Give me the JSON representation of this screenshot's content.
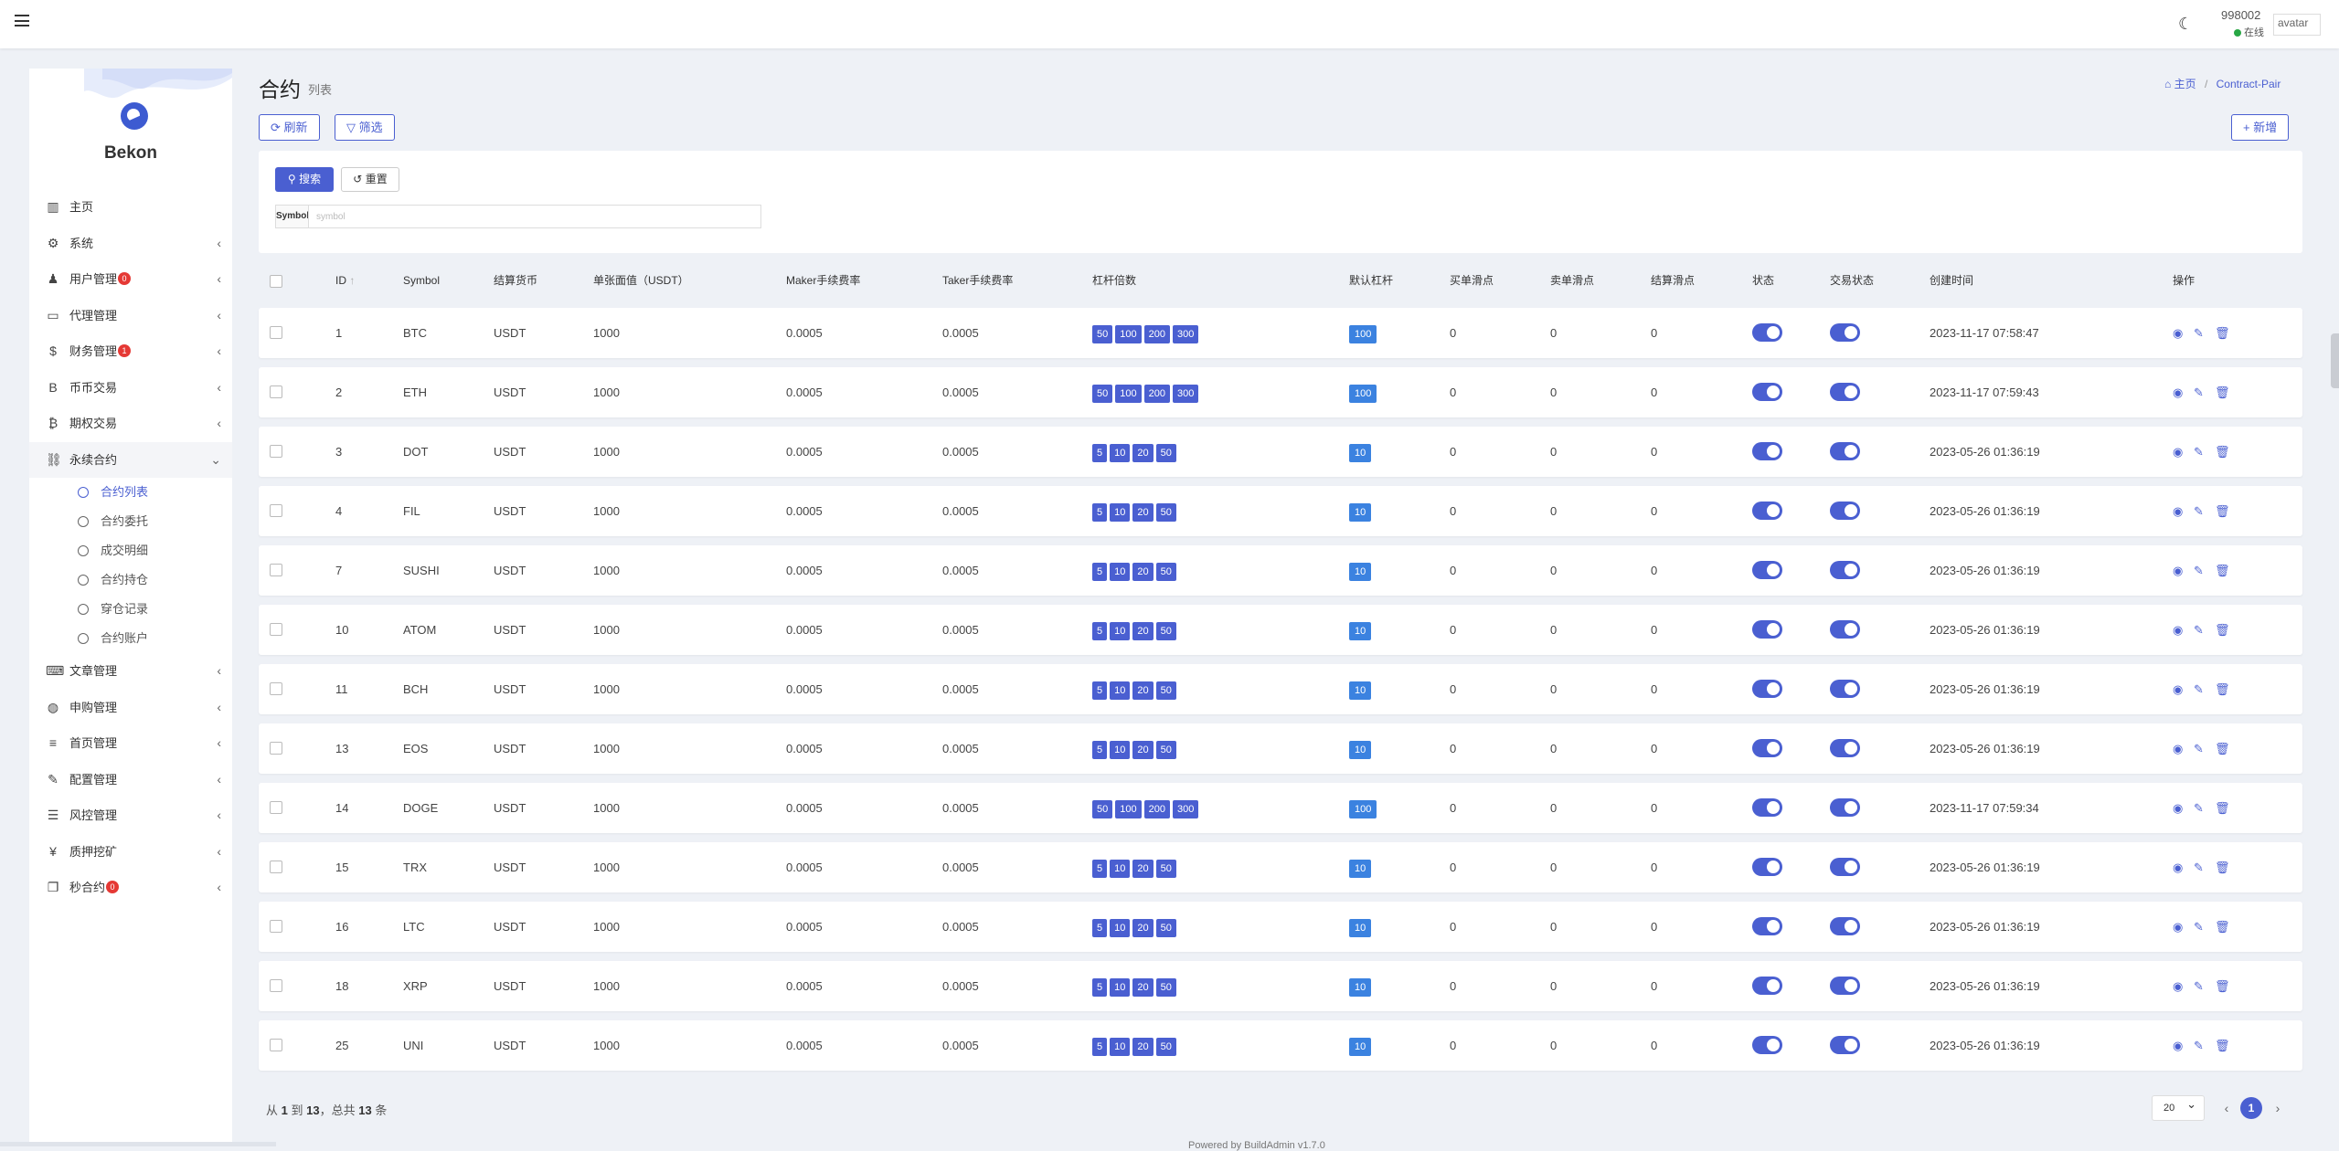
{
  "header": {
    "user_id": "998002",
    "status": "在线",
    "avatar_alt": "avatar"
  },
  "brand": {
    "name": "Bekon"
  },
  "sidebar": {
    "items": [
      {
        "label": "主页",
        "icon": "chart-bar-icon",
        "badge": null,
        "chevron": false
      },
      {
        "label": "系统",
        "icon": "gear-icon",
        "badge": null,
        "chevron": true
      },
      {
        "label": "用户管理",
        "icon": "users-icon",
        "badge": "0",
        "chevron": true
      },
      {
        "label": "代理管理",
        "icon": "id-card-icon",
        "badge": null,
        "chevron": true
      },
      {
        "label": "财务管理",
        "icon": "dollar-icon",
        "badge": "1",
        "chevron": true
      },
      {
        "label": "币币交易",
        "icon": "bitcoin-b-icon",
        "badge": null,
        "chevron": true
      },
      {
        "label": "期权交易",
        "icon": "bitcoin-icon",
        "badge": null,
        "chevron": true
      },
      {
        "label": "永续合约",
        "icon": "link-icon",
        "badge": null,
        "chevron": true,
        "expanded": true
      }
    ],
    "sub_items": [
      {
        "label": "合约列表",
        "active": true
      },
      {
        "label": "合约委托",
        "active": false
      },
      {
        "label": "成交明细",
        "active": false
      },
      {
        "label": "合约持仓",
        "active": false
      },
      {
        "label": "穿仓记录",
        "active": false
      },
      {
        "label": "合约账户",
        "active": false
      }
    ],
    "items_after": [
      {
        "label": "文章管理",
        "icon": "keyboard-icon",
        "badge": null
      },
      {
        "label": "申购管理",
        "icon": "globe-icon",
        "badge": null
      },
      {
        "label": "首页管理",
        "icon": "bars-icon",
        "badge": null
      },
      {
        "label": "配置管理",
        "icon": "wrench-icon",
        "badge": null
      },
      {
        "label": "风控管理",
        "icon": "list-icon",
        "badge": null
      },
      {
        "label": "质押挖矿",
        "icon": "yen-icon",
        "badge": null
      },
      {
        "label": "秒合约",
        "icon": "copy-icon",
        "badge": "0"
      }
    ]
  },
  "page": {
    "title": "合约",
    "subtitle": "列表",
    "breadcrumb_home": "主页",
    "breadcrumb_current": "Contract-Pair"
  },
  "toolbar": {
    "refresh": "刷新",
    "filter": "筛选",
    "add": "新增"
  },
  "search": {
    "search_button": "搜索",
    "reset_button": "重置",
    "field_label": "Symbol",
    "field_placeholder": "symbol"
  },
  "table": {
    "columns": {
      "id": "ID",
      "symbol": "Symbol",
      "settle": "结算货币",
      "face": "单张面值（USDT）",
      "maker": "Maker手续费率",
      "taker": "Taker手续费率",
      "leverages": "杠杆倍数",
      "default_lev": "默认杠杆",
      "buy_slip": "买单滑点",
      "sell_slip": "卖单滑点",
      "settle_slip": "结算滑点",
      "status": "状态",
      "trade_status": "交易状态",
      "created": "创建时间",
      "actions": "操作"
    },
    "rows": [
      {
        "id": "1",
        "symbol": "BTC",
        "settle": "USDT",
        "face": "1000",
        "maker": "0.0005",
        "taker": "0.0005",
        "leverages": [
          "50",
          "100",
          "200",
          "300"
        ],
        "default_lev": "100",
        "buy_slip": "0",
        "sell_slip": "0",
        "settle_slip": "0",
        "status": true,
        "trade_status": true,
        "created": "2023-11-17 07:58:47"
      },
      {
        "id": "2",
        "symbol": "ETH",
        "settle": "USDT",
        "face": "1000",
        "maker": "0.0005",
        "taker": "0.0005",
        "leverages": [
          "50",
          "100",
          "200",
          "300"
        ],
        "default_lev": "100",
        "buy_slip": "0",
        "sell_slip": "0",
        "settle_slip": "0",
        "status": true,
        "trade_status": true,
        "created": "2023-11-17 07:59:43"
      },
      {
        "id": "3",
        "symbol": "DOT",
        "settle": "USDT",
        "face": "1000",
        "maker": "0.0005",
        "taker": "0.0005",
        "leverages": [
          "5",
          "10",
          "20",
          "50"
        ],
        "default_lev": "10",
        "buy_slip": "0",
        "sell_slip": "0",
        "settle_slip": "0",
        "status": true,
        "trade_status": true,
        "created": "2023-05-26 01:36:19"
      },
      {
        "id": "4",
        "symbol": "FIL",
        "settle": "USDT",
        "face": "1000",
        "maker": "0.0005",
        "taker": "0.0005",
        "leverages": [
          "5",
          "10",
          "20",
          "50"
        ],
        "default_lev": "10",
        "buy_slip": "0",
        "sell_slip": "0",
        "settle_slip": "0",
        "status": true,
        "trade_status": true,
        "created": "2023-05-26 01:36:19"
      },
      {
        "id": "7",
        "symbol": "SUSHI",
        "settle": "USDT",
        "face": "1000",
        "maker": "0.0005",
        "taker": "0.0005",
        "leverages": [
          "5",
          "10",
          "20",
          "50"
        ],
        "default_lev": "10",
        "buy_slip": "0",
        "sell_slip": "0",
        "settle_slip": "0",
        "status": true,
        "trade_status": true,
        "created": "2023-05-26 01:36:19"
      },
      {
        "id": "10",
        "symbol": "ATOM",
        "settle": "USDT",
        "face": "1000",
        "maker": "0.0005",
        "taker": "0.0005",
        "leverages": [
          "5",
          "10",
          "20",
          "50"
        ],
        "default_lev": "10",
        "buy_slip": "0",
        "sell_slip": "0",
        "settle_slip": "0",
        "status": true,
        "trade_status": true,
        "created": "2023-05-26 01:36:19"
      },
      {
        "id": "11",
        "symbol": "BCH",
        "settle": "USDT",
        "face": "1000",
        "maker": "0.0005",
        "taker": "0.0005",
        "leverages": [
          "5",
          "10",
          "20",
          "50"
        ],
        "default_lev": "10",
        "buy_slip": "0",
        "sell_slip": "0",
        "settle_slip": "0",
        "status": true,
        "trade_status": true,
        "created": "2023-05-26 01:36:19"
      },
      {
        "id": "13",
        "symbol": "EOS",
        "settle": "USDT",
        "face": "1000",
        "maker": "0.0005",
        "taker": "0.0005",
        "leverages": [
          "5",
          "10",
          "20",
          "50"
        ],
        "default_lev": "10",
        "buy_slip": "0",
        "sell_slip": "0",
        "settle_slip": "0",
        "status": true,
        "trade_status": true,
        "created": "2023-05-26 01:36:19"
      },
      {
        "id": "14",
        "symbol": "DOGE",
        "settle": "USDT",
        "face": "1000",
        "maker": "0.0005",
        "taker": "0.0005",
        "leverages": [
          "50",
          "100",
          "200",
          "300"
        ],
        "default_lev": "100",
        "buy_slip": "0",
        "sell_slip": "0",
        "settle_slip": "0",
        "status": true,
        "trade_status": true,
        "created": "2023-11-17 07:59:34"
      },
      {
        "id": "15",
        "symbol": "TRX",
        "settle": "USDT",
        "face": "1000",
        "maker": "0.0005",
        "taker": "0.0005",
        "leverages": [
          "5",
          "10",
          "20",
          "50"
        ],
        "default_lev": "10",
        "buy_slip": "0",
        "sell_slip": "0",
        "settle_slip": "0",
        "status": true,
        "trade_status": true,
        "created": "2023-05-26 01:36:19"
      },
      {
        "id": "16",
        "symbol": "LTC",
        "settle": "USDT",
        "face": "1000",
        "maker": "0.0005",
        "taker": "0.0005",
        "leverages": [
          "5",
          "10",
          "20",
          "50"
        ],
        "default_lev": "10",
        "buy_slip": "0",
        "sell_slip": "0",
        "settle_slip": "0",
        "status": true,
        "trade_status": true,
        "created": "2023-05-26 01:36:19"
      },
      {
        "id": "18",
        "symbol": "XRP",
        "settle": "USDT",
        "face": "1000",
        "maker": "0.0005",
        "taker": "0.0005",
        "leverages": [
          "5",
          "10",
          "20",
          "50"
        ],
        "default_lev": "10",
        "buy_slip": "0",
        "sell_slip": "0",
        "settle_slip": "0",
        "status": true,
        "trade_status": true,
        "created": "2023-05-26 01:36:19"
      },
      {
        "id": "25",
        "symbol": "UNI",
        "settle": "USDT",
        "face": "1000",
        "maker": "0.0005",
        "taker": "0.0005",
        "leverages": [
          "5",
          "10",
          "20",
          "50"
        ],
        "default_lev": "10",
        "buy_slip": "0",
        "sell_slip": "0",
        "settle_slip": "0",
        "status": true,
        "trade_status": true,
        "created": "2023-05-26 01:36:19"
      }
    ]
  },
  "pagination": {
    "prefix": "从",
    "from": "1",
    "to_word": "到",
    "to": "13",
    "total_word": "，总共",
    "total": "13",
    "suffix": "条",
    "page_size": "20",
    "current_page": "1"
  },
  "footer": {
    "powered": "Powered by BuildAdmin v1.7.0"
  },
  "colors": {
    "accent": "#4a5fd1",
    "default_lev": "#3b82e0",
    "badge": "#e53935",
    "online": "#28a745"
  }
}
